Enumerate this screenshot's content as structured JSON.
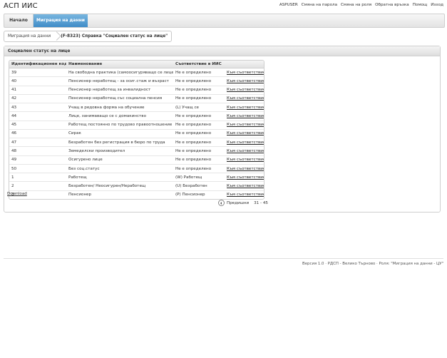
{
  "app": {
    "title": "АСП ИИС"
  },
  "top_links": [
    "ASPUSER",
    "Смяна на парола",
    "Смяна на роля",
    "Обратна връзка",
    "Помощ",
    "Изход"
  ],
  "nav": {
    "tabs": [
      {
        "label": "Начало"
      },
      {
        "label": "Миграция на данни"
      }
    ],
    "active_tab": "Миграция на данни"
  },
  "breadcrumb": {
    "link": "Миграция на данни",
    "current": "(F-8323) Справка \"Социален статус на лице\""
  },
  "panel": {
    "title": "Социален статус на лице"
  },
  "table": {
    "columns": [
      "Идентификационен код",
      "Наименование",
      "Съответствие в ИИС",
      ""
    ],
    "rows": [
      {
        "code": "39",
        "name": "На свободна практика (самоосигуряващо се лице)",
        "match": "Не е определено",
        "action": "Към съответствие"
      },
      {
        "code": "40",
        "name": "Пенсионер неработещ - за осиг.стаж и възраст",
        "match": "Не е определено",
        "action": "Към съответствие"
      },
      {
        "code": "41",
        "name": "Пенсионер неработещ за инвалидност",
        "match": "Не е определено",
        "action": "Към съответствие"
      },
      {
        "code": "42",
        "name": "Пенсионер неработещ със социална пенсия",
        "match": "Не е определено",
        "action": "Към съответствие"
      },
      {
        "code": "43",
        "name": "Учащ в редовна форма на обучение",
        "match": "(L) Учащ се",
        "action": "Към съответствие"
      },
      {
        "code": "44",
        "name": "Лице, занимаващо се с домакинство",
        "match": "Не е определено",
        "action": "Към съответствие"
      },
      {
        "code": "45",
        "name": "Работещ постоянно по трудово правоотношение",
        "match": "Не е определено",
        "action": "Към съответствие"
      },
      {
        "code": "46",
        "name": "Сирак",
        "match": "Не е определено",
        "action": "Към съответствие"
      },
      {
        "code": "47",
        "name": "Безработен без регистрация в бюро по труда",
        "match": "Не е определено",
        "action": "Към съответствие"
      },
      {
        "code": "48",
        "name": "Земеделски производител",
        "match": "Не е определено",
        "action": "Към съответствие"
      },
      {
        "code": "49",
        "name": "Осигурено лице",
        "match": "Не е определено",
        "action": "Към съответствие"
      },
      {
        "code": "50",
        "name": "Без соц.статус",
        "match": "Не е определено",
        "action": "Към съответствие"
      },
      {
        "code": "1",
        "name": "Работещ",
        "match": "(W) Работещ",
        "action": "Към съответствие"
      },
      {
        "code": "2",
        "name": "Безработен/ Неосигурен/Неработещ",
        "match": "(U) Безработен",
        "action": "Към съответствие"
      },
      {
        "code": "3",
        "name": "Пенсионер",
        "match": "(P) Пенсионер",
        "action": "Към съответствие"
      }
    ]
  },
  "download": {
    "label": "Download"
  },
  "pager": {
    "prev_label": "Предишни",
    "range": "31 - 45",
    "icon": "chevron-left-circle-icon"
  },
  "footer": {
    "text": "Версия 1.0 · РДСП - Велико Търново · Роля: \"Миграция на данни - ЦУ\""
  },
  "colors": {
    "active_tab": "#4a96cf",
    "panel_header": "#e6e6e6"
  }
}
